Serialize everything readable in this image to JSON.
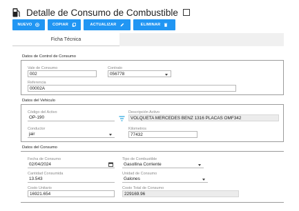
{
  "header": {
    "title": "Detalle de Consumo de Combustible"
  },
  "toolbar": {
    "new_label": "NUEVO",
    "copy_label": "COPIAR",
    "update_label": "ACTUALIZAR",
    "delete_label": "ELIMINAR"
  },
  "tabs": [
    {
      "label": "Ficha Técnica"
    }
  ],
  "control": {
    "section_title": "Datos de Control de Consumo",
    "vale_label": "Vale de Consumo",
    "vale_value": "002",
    "contrato_label": "Contrato",
    "contrato_value": "056778",
    "referencia_label": "Referencia",
    "referencia_value": "00002A"
  },
  "vehiculo": {
    "section_title": "Datos del Vehiculo",
    "codigo_label": "Código del Activo",
    "codigo_value": "OP-190",
    "descripcion_label": "Descripción Activo",
    "descripcion_value": "VOLQUETA MERCEDES BENZ 1316 PLACAS OMF342",
    "conductor_label": "Conductor",
    "conductor_value": "jair",
    "kilometros_label": "Kilometros",
    "kilometros_value": "77432"
  },
  "consumo": {
    "section_title": "Datos del Consumo",
    "fecha_label": "Fecha de Consumo",
    "fecha_value": "02/04/2024",
    "tipo_label": "Tipo de Combustible",
    "tipo_value": "Gasollina Corriente",
    "cantidad_label": "Cantidad Consumida",
    "cantidad_value": "13.543",
    "unidad_label": "Unidad de Consumo",
    "unidad_value": "Galones",
    "costo_unitario_label": "Costo Unitario",
    "costo_unitario_value": "16921.654",
    "costo_total_label": "Costo Total de Consumo",
    "costo_total_value": "229169.96"
  },
  "colors": {
    "accent": "#2196f3",
    "filter_icon": "#29a8e0"
  }
}
